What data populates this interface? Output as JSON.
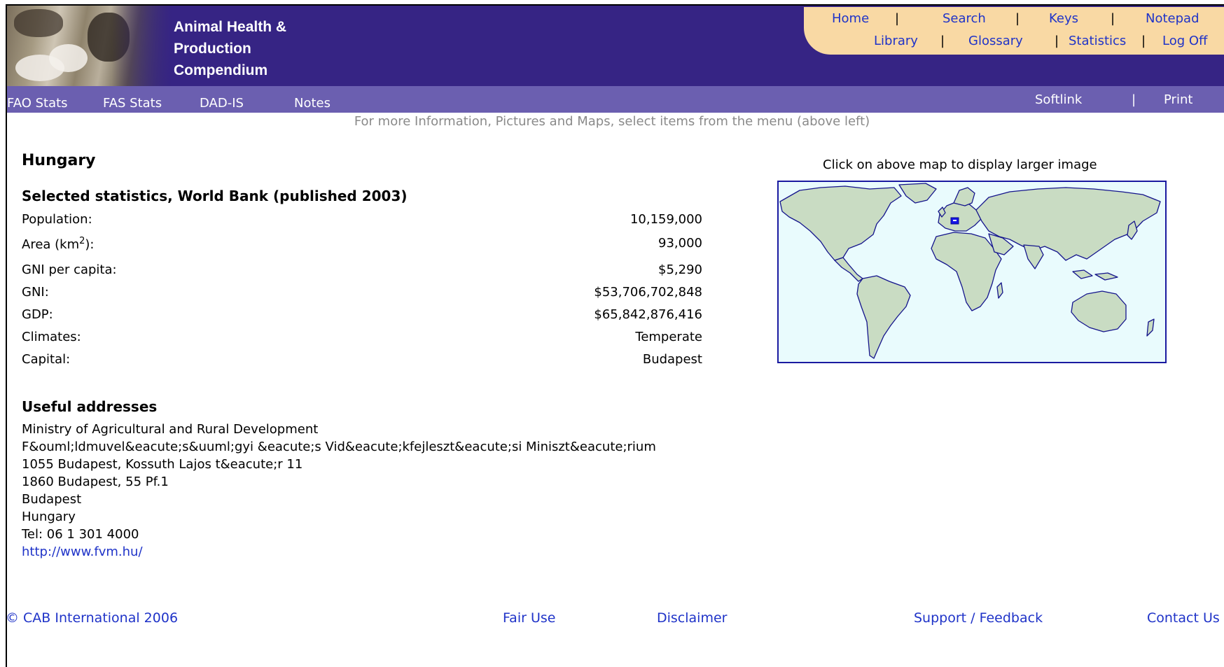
{
  "header": {
    "title": "Animal Health &\nProduction\nCompendium",
    "nav": {
      "home": "Home",
      "search": "Search",
      "keys": "Keys",
      "notepad": "Notepad",
      "library": "Library",
      "glossary": "Glossary",
      "statistics": "Statistics",
      "logoff": "Log Off",
      "separator": "|"
    }
  },
  "menubar": {
    "fao": "FAO Stats",
    "fas": "FAS Stats",
    "dadis": "DAD-IS",
    "notes": "Notes",
    "softlink": "Softlink",
    "print": "Print",
    "separator": "|"
  },
  "instruction": "For more Information, Pictures and Maps, select items from the menu (above left)",
  "country": "Hungary",
  "stats": {
    "heading": "Selected statistics, World Bank (published 2003)",
    "rows": [
      {
        "label": "Population:",
        "value": "10,159,000"
      },
      {
        "label_prefix": "Area (km",
        "label_sup": "2",
        "label_suffix": "):",
        "value": "93,000"
      },
      {
        "label": "GNI per capita:",
        "value": "$5,290"
      },
      {
        "label": "GNI:",
        "value": "$53,706,702,848"
      },
      {
        "label": "GDP:",
        "value": "$65,842,876,416"
      },
      {
        "label": "Climates:",
        "value": "Temperate"
      },
      {
        "label": "Capital:",
        "value": "Budapest"
      }
    ]
  },
  "addresses": {
    "heading": "Useful addresses",
    "lines": [
      "Ministry of Agricultural and Rural Development",
      "F&ouml;ldmuvel&eacute;s&uuml;gyi &eacute;s Vid&eacute;kfejleszt&eacute;si Miniszt&eacute;rium",
      "1055 Budapest, Kossuth Lajos t&eacute;r 11",
      "1860 Budapest, 55 Pf.1",
      "Budapest",
      "Hungary",
      "Tel: 06 1 301 4000"
    ],
    "link": "http://www.fvm.hu/"
  },
  "map": {
    "caption": "Click on above map to display larger image",
    "highlight_color": "#1414e6",
    "land_color": "#c9dcc3",
    "sea_color": "#e9fbfd",
    "outline_color": "#14148c"
  },
  "footer": {
    "copyright": "© CAB International 2006",
    "fair_use": "Fair Use",
    "disclaimer": "Disclaimer",
    "support": "Support / Feedback",
    "contact": "Contact Us"
  }
}
